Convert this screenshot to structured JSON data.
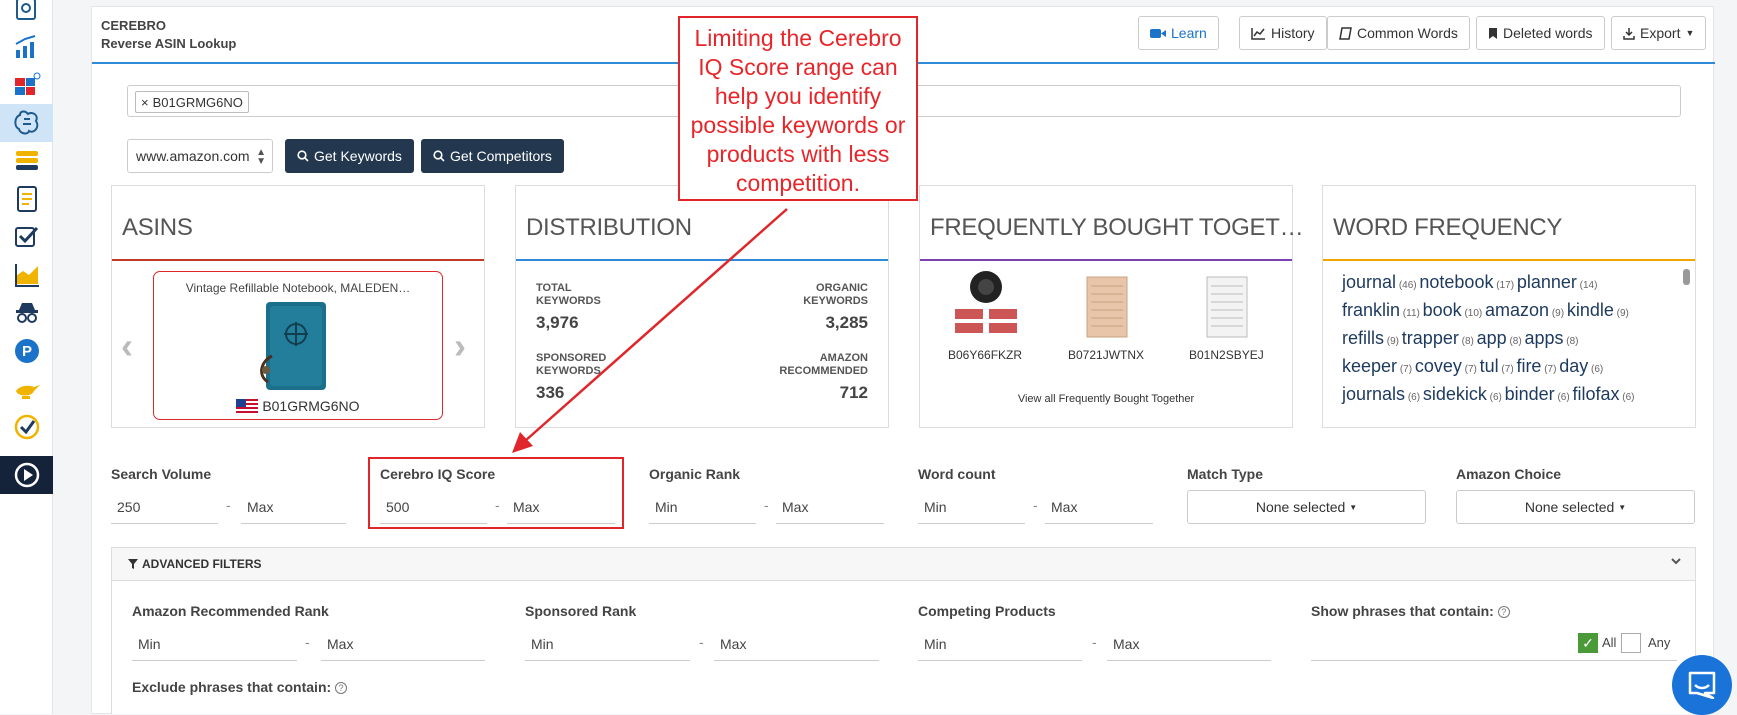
{
  "sidebar": {
    "items": [
      {
        "icon": "book-search-icon",
        "color": "#1e5a8c"
      },
      {
        "icon": "trend-chart-icon",
        "color": "#1a73c8"
      },
      {
        "icon": "squares-icon",
        "color": "#e0262a"
      },
      {
        "icon": "brain-icon",
        "color": "#1e5a8c",
        "active": true
      },
      {
        "icon": "layers-icon",
        "color": "#f0b400"
      },
      {
        "icon": "document-list-icon",
        "color": "#1e3a5f"
      },
      {
        "icon": "checkbox-icon",
        "color": "#1e3a5f"
      },
      {
        "icon": "area-chart-icon",
        "color": "#f0b400"
      },
      {
        "icon": "spy-icon",
        "color": "#1e3a5f"
      },
      {
        "icon": "p-circle-icon",
        "color": "#1a73c8"
      },
      {
        "icon": "genie-lamp-icon",
        "color": "#f0b400"
      },
      {
        "icon": "check-circle-icon",
        "color": "#f0b400"
      },
      {
        "icon": "play-circle-icon",
        "color": "#ffffff"
      }
    ]
  },
  "header": {
    "title": "CEREBRO",
    "subtitle": "Reverse ASIN Lookup",
    "buttons": {
      "learn": "Learn",
      "history": "History",
      "common_words": "Common Words",
      "deleted_words": "Deleted words",
      "export": "Export"
    }
  },
  "search": {
    "tag": "B01GRMG6NO",
    "tag_remove": "×",
    "marketplace": "www.amazon.com",
    "get_keywords": "Get Keywords",
    "get_competitors": "Get Competitors"
  },
  "cards": {
    "asins": {
      "title": "ASINS",
      "product_title": "Vintage Refillable Notebook, MALEDEN…",
      "asin": "B01GRMG6NO"
    },
    "distribution": {
      "title": "DISTRIBUTION",
      "total_keywords_label_1": "TOTAL",
      "total_keywords_label_2": "KEYWORDS",
      "total_keywords": "3,976",
      "organic_keywords_label_1": "ORGANIC",
      "organic_keywords_label_2": "KEYWORDS",
      "organic_keywords": "3,285",
      "sponsored_keywords_label_1": "SPONSORED",
      "sponsored_keywords_label_2": "KEYWORDS",
      "sponsored_keywords": "336",
      "amazon_recommended_label_1": "AMAZON",
      "amazon_recommended_label_2": "RECOMMENDED",
      "amazon_recommended": "712"
    },
    "fbt": {
      "title": "FREQUENTLY BOUGHT TOGET…",
      "asins": [
        "B06Y66FKZR",
        "B0721JWTNX",
        "B01N2SBYEJ"
      ],
      "link": "View all Frequently Bought Together"
    },
    "word_frequency": {
      "title": "WORD FREQUENCY",
      "lines": [
        [
          {
            "w": "journal",
            "c": "(46)"
          },
          {
            "w": "notebook",
            "c": "(17)"
          },
          {
            "w": "planner",
            "c": "(14)"
          }
        ],
        [
          {
            "w": "franklin",
            "c": "(11)"
          },
          {
            "w": "book",
            "c": "(10)"
          },
          {
            "w": "amazon",
            "c": "(9)"
          },
          {
            "w": "kindle",
            "c": "(9)"
          }
        ],
        [
          {
            "w": "refills",
            "c": "(9)"
          },
          {
            "w": "trapper",
            "c": "(8)"
          },
          {
            "w": "app",
            "c": "(8)"
          },
          {
            "w": "apps",
            "c": "(8)"
          }
        ],
        [
          {
            "w": "keeper",
            "c": "(7)"
          },
          {
            "w": "covey",
            "c": "(7)"
          },
          {
            "w": "tul",
            "c": "(7)"
          },
          {
            "w": "fire",
            "c": "(7)"
          },
          {
            "w": "day",
            "c": "(6)"
          }
        ],
        [
          {
            "w": "journals",
            "c": "(6)"
          },
          {
            "w": "sidekick",
            "c": "(6)"
          },
          {
            "w": "binder",
            "c": "(6)"
          },
          {
            "w": "filofax",
            "c": "(6)"
          }
        ]
      ]
    }
  },
  "filters": {
    "search_volume": {
      "label": "Search Volume",
      "min": "250",
      "max": "Max"
    },
    "cerebro_iq": {
      "label": "Cerebro IQ Score",
      "min": "500",
      "max": "Max"
    },
    "organic_rank": {
      "label": "Organic Rank",
      "min": "Min",
      "max": "Max"
    },
    "word_count": {
      "label": "Word count",
      "min": "Min",
      "max": "Max"
    },
    "match_type": {
      "label": "Match Type",
      "value": "None selected"
    },
    "amazon_choice": {
      "label": "Amazon Choice",
      "value": "None selected"
    },
    "dash": "-"
  },
  "advanced": {
    "title": "ADVANCED FILTERS",
    "amazon_rec_rank": {
      "label": "Amazon Recommended Rank",
      "min": "Min",
      "max": "Max"
    },
    "sponsored_rank": {
      "label": "Sponsored Rank",
      "min": "Min",
      "max": "Max"
    },
    "competing_products": {
      "label": "Competing Products",
      "min": "Min",
      "max": "Max"
    },
    "show_phrases": {
      "label": "Show phrases that contain:",
      "all": "All",
      "any": "Any"
    },
    "exclude_phrases": {
      "label": "Exclude phrases that contain:"
    }
  },
  "annotation": {
    "text": "Limiting the Cerebro IQ Score range can help you identify possible keywords or products with less competition."
  },
  "colors": {
    "accent_blue": "#2f8ad8",
    "dark_button": "#23384f",
    "annotation_red": "#e0262a",
    "asins_line": "#c0392b",
    "distribution_line": "#2f8ad8",
    "fbt_line": "#7b3fb0",
    "wordfreq_line": "#f0a500"
  }
}
